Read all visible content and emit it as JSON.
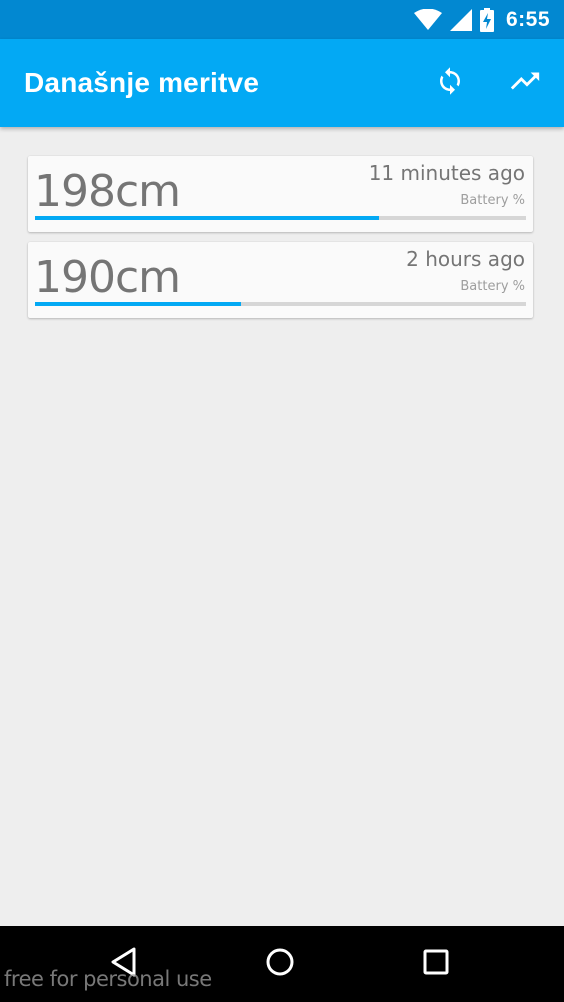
{
  "status_bar": {
    "time": "6:55",
    "icons": [
      "wifi-icon",
      "signal-icon",
      "battery-charging-icon"
    ]
  },
  "app_bar": {
    "title": "Današnje meritve",
    "actions": [
      {
        "name": "refresh-button",
        "icon": "refresh-icon"
      },
      {
        "name": "trend-button",
        "icon": "trending-up-icon"
      }
    ]
  },
  "colors": {
    "status_bar": "#0288d1",
    "app_bar": "#03a9f4",
    "accent": "#03a9f4",
    "background": "#eeeeee"
  },
  "measurements": [
    {
      "value": "198cm",
      "time": "11 minutes ago",
      "battery_label": "Battery %",
      "battery_fraction": 0.7
    },
    {
      "value": "190cm",
      "time": "2 hours ago",
      "battery_label": "Battery %",
      "battery_fraction": 0.42
    }
  ],
  "nav_bar": {
    "buttons": [
      {
        "name": "back-button",
        "icon": "back-triangle-icon"
      },
      {
        "name": "home-button",
        "icon": "home-circle-icon"
      },
      {
        "name": "recents-button",
        "icon": "recents-square-icon"
      }
    ]
  },
  "watermark": "free for personal use"
}
